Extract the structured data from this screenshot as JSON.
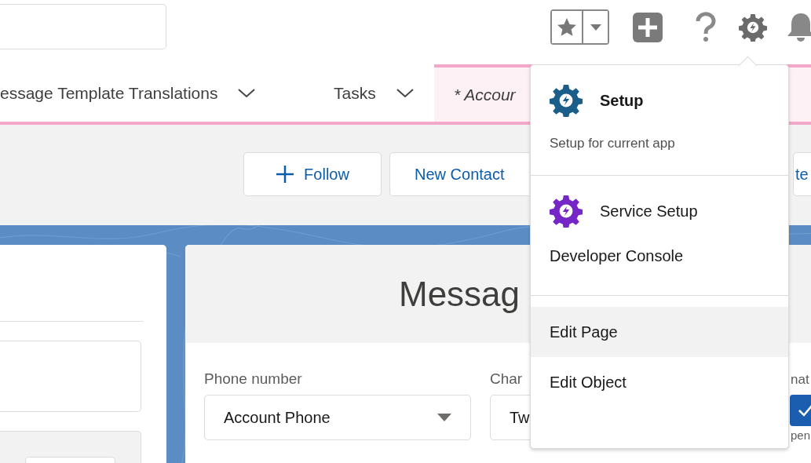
{
  "tabs": [
    {
      "label": "essage Template Translations",
      "selected": false,
      "chevron": true
    },
    {
      "label": "Tasks",
      "selected": false,
      "chevron": true
    },
    {
      "label": "* Accour",
      "selected": true,
      "chevron": false
    }
  ],
  "actions": [
    {
      "label": "Follow",
      "kind": "follow"
    },
    {
      "label": "New Contact",
      "kind": "plain"
    },
    {
      "label": "te",
      "kind": "edge"
    }
  ],
  "record_card": {
    "title": "Messag",
    "fields": [
      {
        "kind": "select",
        "label": "Phone number",
        "value": "Account Phone",
        "caret": true
      },
      {
        "kind": "select",
        "label": "Char",
        "value": "Tw"
      },
      {
        "kind": "checkbox",
        "label": "nat",
        "caption": "pen",
        "checked": true
      }
    ]
  },
  "setup_menu": {
    "sections": [
      {
        "items": [
          {
            "kind": "primary",
            "label": "Setup",
            "description": "Setup for current app",
            "color": "#1b5e8a",
            "selected": false
          }
        ]
      },
      {
        "items": [
          {
            "kind": "app",
            "label": "Service Setup",
            "color": "#7526c7",
            "selected": false
          },
          {
            "kind": "link",
            "label": "Developer Console",
            "selected": false
          }
        ]
      },
      {
        "items": [
          {
            "kind": "link",
            "label": "Edit Page",
            "selected": true
          },
          {
            "kind": "link",
            "label": "Edit Object",
            "selected": false
          }
        ]
      }
    ]
  }
}
